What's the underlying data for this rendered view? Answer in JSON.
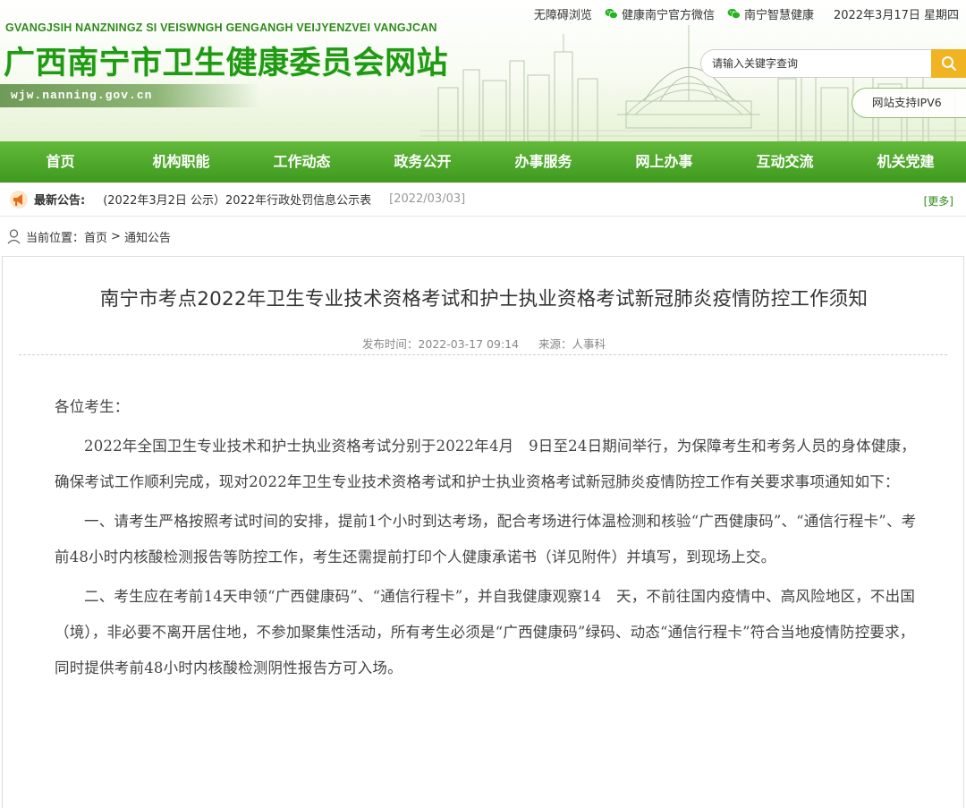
{
  "header": {
    "pinyin": "GVANGJSIH NANZNINGZ SI VEISWNGH GENGANGH VEIJYENZVEI VANGJCAN",
    "title": "广西南宁市卫生健康委员会网站",
    "domain": "wjw.nanning.gov.cn",
    "toplinks": {
      "accessible": "无障碍浏览",
      "wechat_official": "健康南宁官方微信",
      "smart_health": "南宁智慧健康",
      "date": "2022年3月17日 星期四"
    },
    "search": {
      "placeholder": "请输入关键字查询"
    },
    "ipv6": "网站支持IPV6"
  },
  "nav": {
    "items": [
      "首页",
      "机构职能",
      "工作动态",
      "政务公开",
      "办事服务",
      "网上办事",
      "互动交流",
      "机关党建"
    ]
  },
  "notice": {
    "label": "最新公告:",
    "text": "(2022年3月2日 公示）2022年行政处罚信息公示表",
    "date": "[2022/03/03]",
    "more": "[更多]"
  },
  "breadcrumb": {
    "prefix": "当前位置：",
    "home": "首页",
    "separator": ">",
    "current": "通知公告"
  },
  "article": {
    "title": "南宁市考点2022年卫生专业技术资格考试和护士执业资格考试新冠肺炎疫情防控工作须知",
    "published": "发布时间：2022-03-17 09:14",
    "source": "来源：人事科",
    "greeting": "各位考生：",
    "paragraphs": [
      "2022年全国卫生专业技术和护士执业资格考试分别于2022年4月　9日至24日期间举行，为保障考生和考务人员的身体健康，确保考试工作顺利完成，现对2022年卫生专业技术资格考试和护士执业资格考试新冠肺炎疫情防控工作有关要求事项通知如下：",
      "一、请考生严格按照考试时间的安排，提前1个小时到达考场，配合考场进行体温检测和核验“广西健康码”、“通信行程卡”、考前48小时内核酸检测报告等防控工作，考生还需提前打印个人健康承诺书（详见附件）并填写，到现场上交。",
      "二、考生应在考前14天申领“广西健康码”、“通信行程卡”，并自我健康观察14　天，不前往国内疫情中、高风险地区，不出国（境），非必要不离开居住地，不参加聚集性活动，所有考生必须是“广西健康码”绿码、动态“通信行程卡”符合当地疫情防控要求，同时提供考前48小时内核酸检测阴性报告方可入场。"
    ]
  },
  "colors": {
    "brand_green": "#1f9a13",
    "nav_green": "#4aa828",
    "search_button": "#f0b423"
  }
}
